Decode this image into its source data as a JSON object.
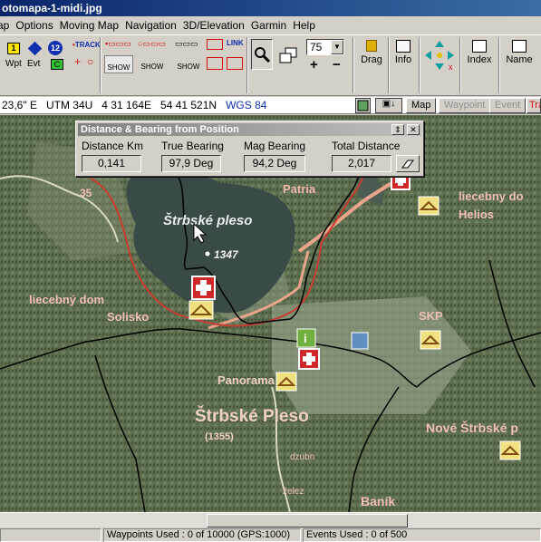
{
  "window": {
    "title": "otomapa-1-midi.jpg"
  },
  "menu": [
    "ap",
    "Options",
    "Moving Map",
    "Navigation",
    "3D/Elevation",
    "Garmin",
    "Help"
  ],
  "toolbar": {
    "wpt_label": "Wpt",
    "evt_label": "Evt",
    "badge_12": "12",
    "track_label": "TRACK",
    "show_label": "SHOW",
    "link_label": "LINK",
    "zoom_value": "75",
    "drag_label": "Drag",
    "info_label": "Info",
    "index_label": "Index",
    "name_label": "Name"
  },
  "coords": {
    "lon": "23,6\" E",
    "utm_zone": "UTM  34U",
    "easting": "4 31 164E",
    "northing": "54 41 521N",
    "datum": "WGS 84"
  },
  "mode_buttons": {
    "map": "Map",
    "waypoint": "Waypoint",
    "event": "Event",
    "track": "Tra"
  },
  "dialog": {
    "title": "Distance & Bearing from Position",
    "distance_label": "Distance Km",
    "distance_value": "0,141",
    "true_label": "True Bearing",
    "true_value": "97,9 Deg",
    "mag_label": "Mag Bearing",
    "mag_value": "94,2 Deg",
    "total_label": "Total Distance",
    "total_value": "2,017"
  },
  "map_labels": {
    "lake": "Štrbské pleso",
    "elevation": "1347",
    "resort": "Štrbské Pleso",
    "resort_elev": "(1355)",
    "panorama": "Panorama",
    "patria": "Patria",
    "liecebny_right": "liecebny do",
    "helios": "Helios",
    "liecebny_left": "liecebný dom",
    "solisko": "Solisko",
    "skp": "SKP",
    "nove": "Nové Štrbské p",
    "banik": "Baník",
    "road35": "35",
    "zelez": "želez",
    "dzubn": "dzubn"
  },
  "status": {
    "waypoints": "Waypoints Used : 0 of 10000  (GPS:1000)",
    "events": "Events Used : 0 of 500"
  },
  "colors": {
    "titlebar": "#0a246a",
    "red_icon": "#d01010",
    "blue_icon": "#1040c0",
    "map_bg": "#6a7a5c"
  }
}
